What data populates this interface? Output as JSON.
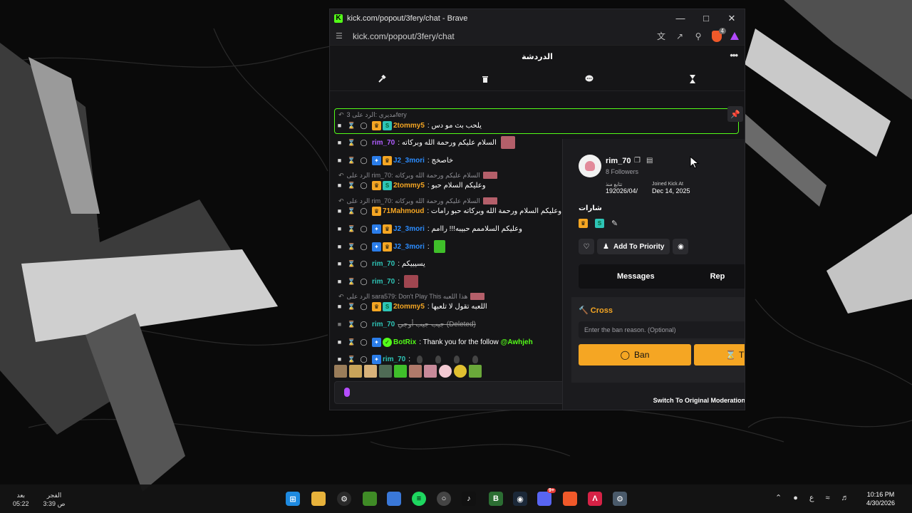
{
  "browser": {
    "window_title": "kick.com/popout/3fery/chat - Brave",
    "url": "kick.com/popout/3fery/chat",
    "shield_count": "4"
  },
  "chat": {
    "header_title": "الدردشة",
    "pinned_reply": "مديري :الرد على 3fery",
    "messages": [
      {
        "user": "2tommy5",
        "color": "#f5a623",
        "text": ": يلحب بث مو دس",
        "badges": [
          "crown",
          "sub"
        ]
      },
      {
        "user": "rim_70",
        "color": "#b05cff",
        "text": ": السلام عليكم ورحمة الله وبركاته",
        "badges": []
      },
      {
        "user": "J2_3mori",
        "color": "#2b8cff",
        "text": ": خاصخج",
        "badges": [
          "vip",
          "crown"
        ]
      },
      {
        "user": "2tommy5",
        "color": "#f5a623",
        "text": ": وعليكم السلام حبو",
        "badges": [
          "crown",
          "sub"
        ]
      },
      {
        "user": "71Mahmoud",
        "color": "#f5a623",
        "text": ": وعليكم السلام ورحمة الله وبركاته حبو رامات",
        "badges": [
          "crown"
        ]
      },
      {
        "user": "J2_3mori",
        "color": "#2b8cff",
        "text": ": وعليكم السلاممم حبيبه!!! راامم",
        "badges": [
          "vip",
          "crown"
        ]
      },
      {
        "user": "J2_3mori",
        "color": "#2b8cff",
        "text": ":",
        "badges": [
          "vip",
          "crown"
        ]
      },
      {
        "user": "rim_70",
        "color": "#2ec4b6",
        "text": ": يسيبيكم",
        "badges": []
      },
      {
        "user": "rim_70",
        "color": "#2ec4b6",
        "text": ":",
        "badges": []
      },
      {
        "user": "2tommy5",
        "color": "#f5a623",
        "text": ": اللعبه تقول لا تلعبها",
        "badges": [
          "crown",
          "sub"
        ]
      },
      {
        "user": "rim_70",
        "color": "#2ec4b6",
        "text": "جيب جيب أوجي (Deleted)",
        "badges": []
      },
      {
        "user": "BotRix",
        "color": "#53fc18",
        "text": ": Thank you for the follow",
        "mention": "@Awhjeh",
        "badges": [
          "vip",
          "bot"
        ]
      },
      {
        "user": "rim_70",
        "color": "#2ec4b6",
        "text": ":",
        "badges": [
          "vip"
        ]
      }
    ],
    "replies": [
      "الرد على rim_70: السلام عليكم ورحمة الله وبركاته",
      "الرد على rim_70: السلام عليكم ورحمة الله وبركاته",
      "الرد على sara579: Don't Play This هذا اللعبه"
    ]
  },
  "user_card": {
    "username": "rim_70",
    "followers": "8 Followers",
    "following_since_label": "تتابع منذ",
    "following_since": "192026/04/",
    "joined_label": "Joined Kick At",
    "joined": "Dec 14, 2025",
    "badges_title": "شارات",
    "add_priority": "Add To Priority",
    "tab_messages": "Messages",
    "tab_replies": "Rep",
    "cross_title": "Cross",
    "ban_placeholder": "Enter the ban reason. (Optional)",
    "ban_label": "Ban",
    "timeout_label": "T",
    "switch_label": "Switch To Original Moderation"
  },
  "taskbar": {
    "prayer_name": "الفجر",
    "prayer_time": "3:39 ص",
    "after_label": "بعد",
    "after_value": "05:22",
    "lang": "ع",
    "time": "10:16 PM",
    "date": "4/30/2026",
    "discord_count": "9+"
  },
  "colors": {
    "kick_green": "#53fc18",
    "accent_orange": "#f5a623",
    "brave_orange": "#f0592a"
  }
}
